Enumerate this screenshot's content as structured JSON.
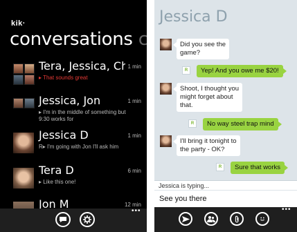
{
  "left": {
    "logo": "kik·",
    "pivot_title": "conversations",
    "pivot_next": "c",
    "conversations": [
      {
        "name": "Tera, Jessica, Ch",
        "time": "1 min",
        "preview": "▸ That sounds great",
        "preview_color": "#e53935"
      },
      {
        "name": "Jessica, Jon",
        "time": "1 min",
        "preview": "▸ I'm in the middle of something but 9:30 works for"
      },
      {
        "name": "Jessica D",
        "time": "1 min",
        "preview": "R▸ I'm going with Jon I'll ask him"
      },
      {
        "name": "Tera D",
        "time": "6 min",
        "preview": "▸ Like this one!"
      },
      {
        "name": "Jon M",
        "time": "12 min",
        "preview": ""
      }
    ],
    "appbar": {
      "chat_icon": "chat-bubble-icon",
      "settings_icon": "gear-icon",
      "more": "•••"
    }
  },
  "right": {
    "title": "Jessica D",
    "messages": [
      {
        "dir": "in",
        "text": "Did you see the\ngame?"
      },
      {
        "dir": "out",
        "text": "Yep! And you owe me $20!",
        "receipt": "R"
      },
      {
        "dir": "in",
        "text": "Shoot, I thought you\nmight forget about\nthat."
      },
      {
        "dir": "out",
        "text": "No way steel trap mind",
        "receipt": "R"
      },
      {
        "dir": "in",
        "text": "I'll bring it tonight to\nthe party - OK?"
      },
      {
        "dir": "out",
        "text": "Sure that works",
        "receipt": "R"
      }
    ],
    "typing_status": "Jessica is typing...",
    "compose_text": "See you there",
    "appbar": {
      "more": "•••"
    }
  },
  "colors": {
    "accent_green": "#99d341",
    "alert_red": "#e53935",
    "chat_bg": "#dde4e9"
  }
}
